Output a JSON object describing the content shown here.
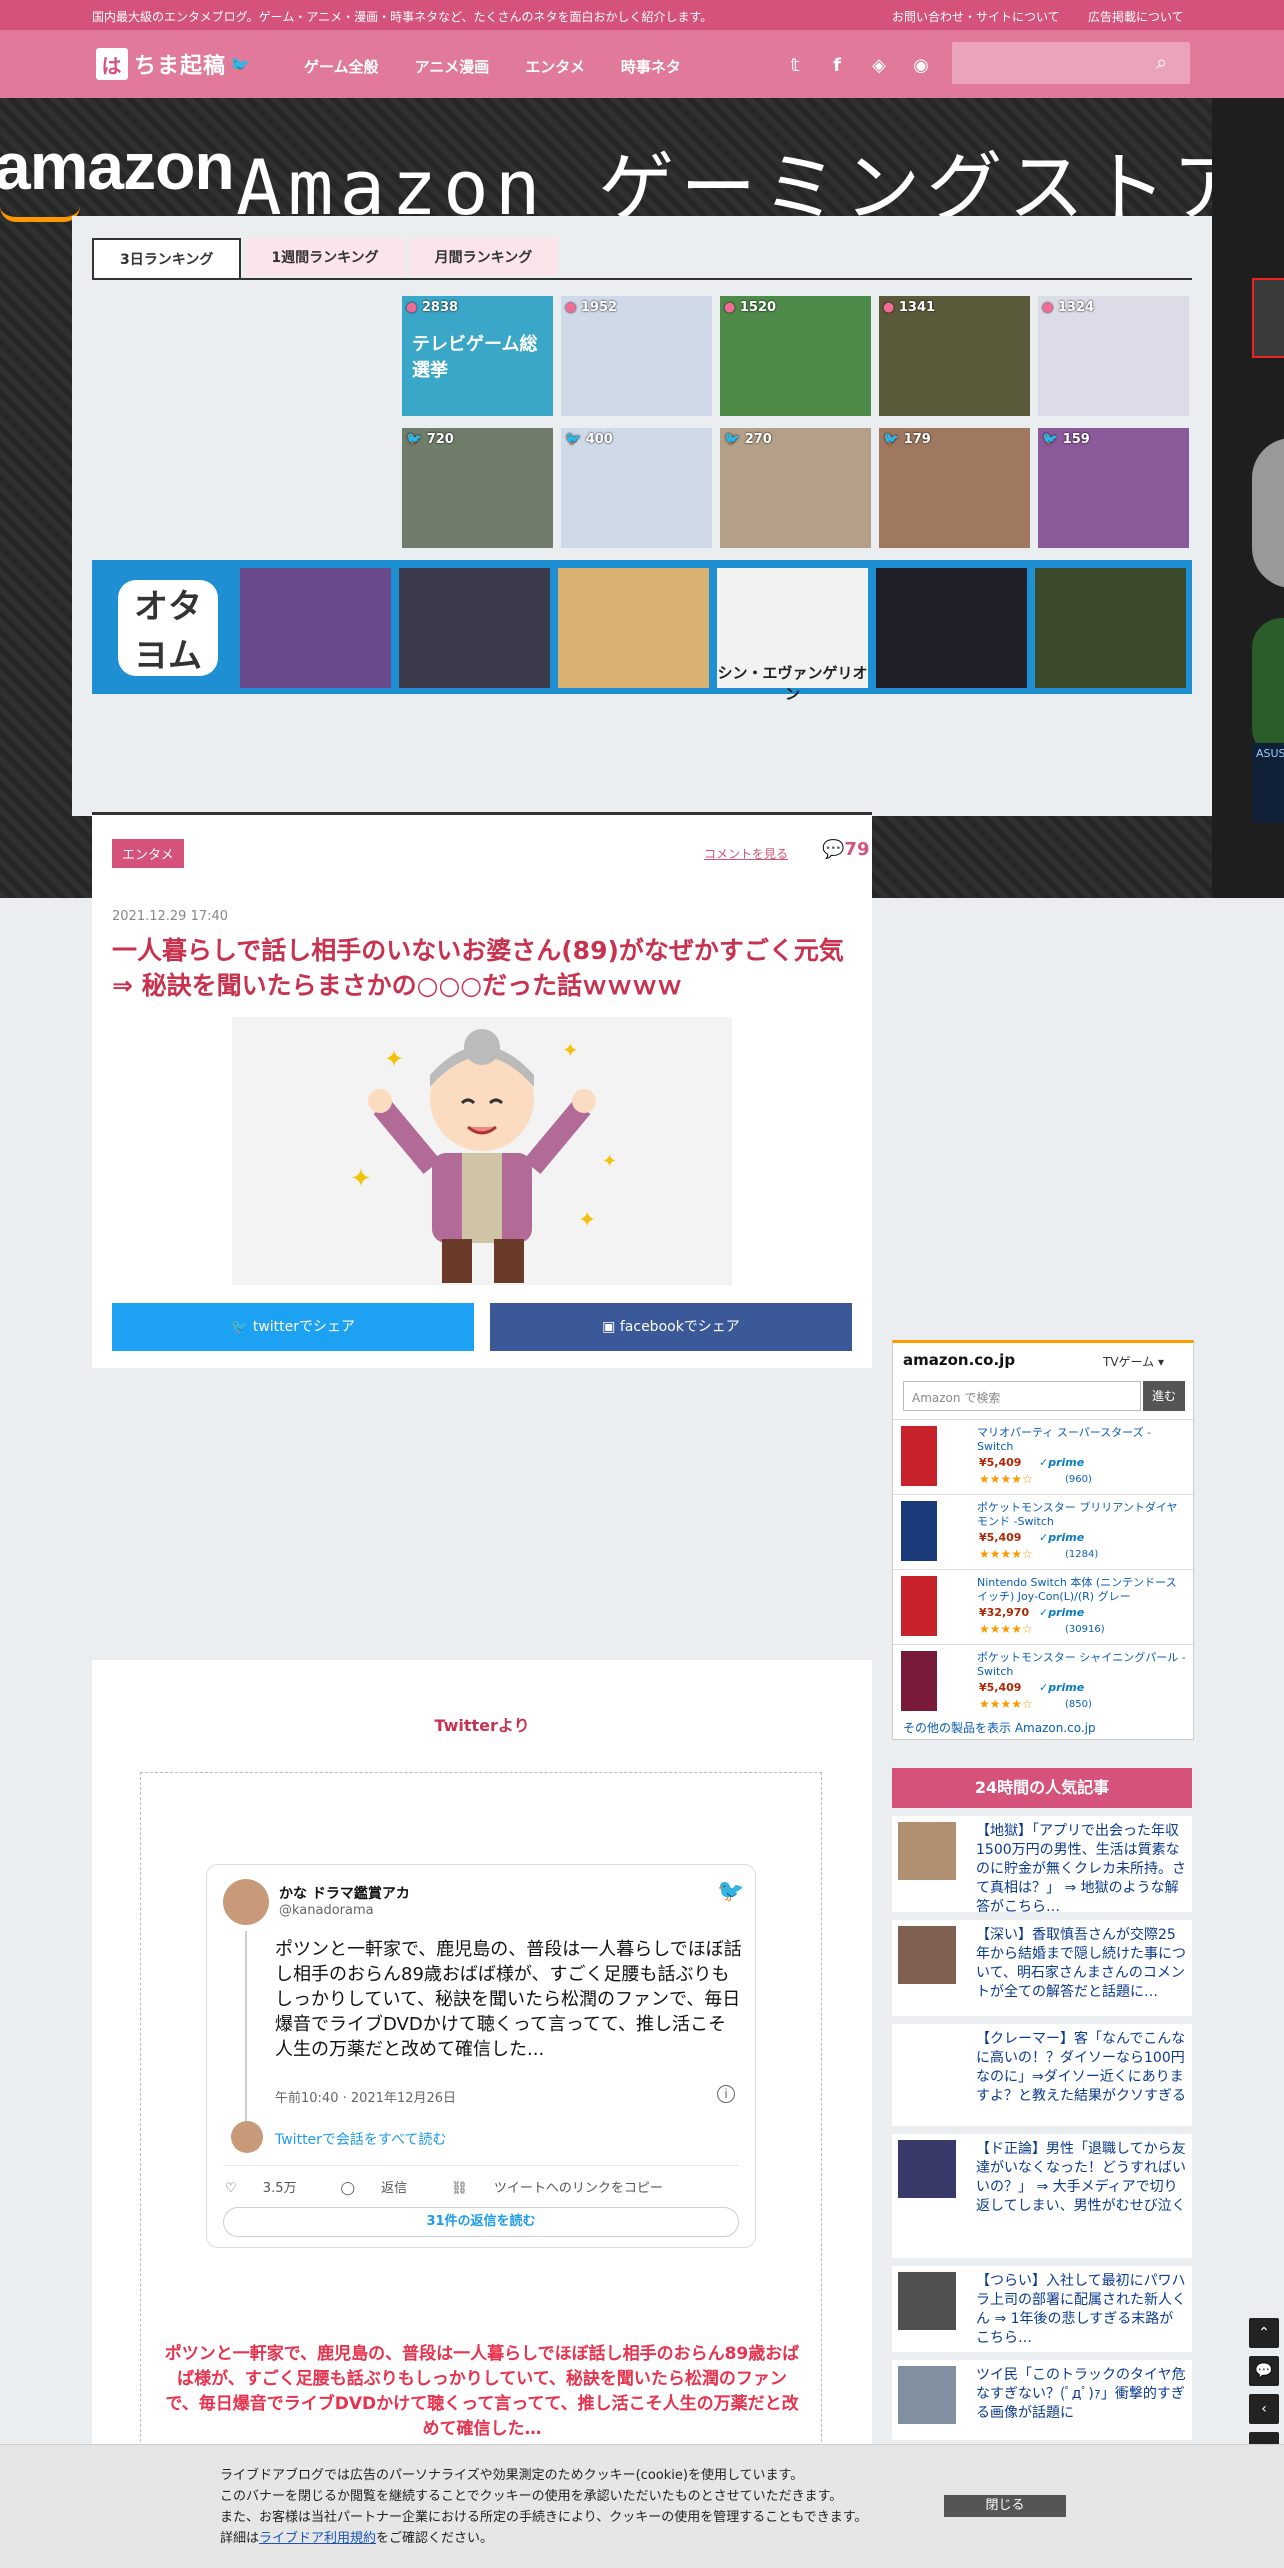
{
  "topbar": {
    "description": "国内最大級のエンタメブログ。ゲーム・アニメ・漫画・時事ネタなど、たくさんのネタを面白おかしく紹介します。",
    "links": [
      "お問い合わせ・サイトについて",
      "広告掲載について"
    ]
  },
  "header": {
    "logo_mark": "は",
    "logo_text": "ちま起稿",
    "nav": [
      "ゲーム全般",
      "アニメ漫画",
      "エンタメ",
      "時事ネタ"
    ],
    "social_icons": [
      "twitter-icon",
      "facebook-icon",
      "feedly-icon",
      "rss-icon"
    ],
    "search_placeholder": ""
  },
  "banner": {
    "brand": "amazon",
    "headline": "Amazon ゲーミングストア"
  },
  "ranking": {
    "tabs": [
      "3日ランキング",
      "1週間ランキング",
      "月間ランキング"
    ],
    "row1": [
      {
        "count": "2838",
        "thumb_text": "テレビゲーム総選挙",
        "color": "#3aa6c8"
      },
      {
        "count": "1952",
        "thumb_text": "",
        "color": "#cfd9e8"
      },
      {
        "count": "1520",
        "thumb_text": "",
        "color": "#4e8a48"
      },
      {
        "count": "1341",
        "thumb_text": "",
        "color": "#5a5a3a"
      },
      {
        "count": "1324",
        "thumb_text": "",
        "color": "#dcdce8"
      }
    ],
    "row2": [
      {
        "count": "720",
        "thumb_text": "",
        "color": "#6f7d6a"
      },
      {
        "count": "400",
        "thumb_text": "",
        "color": "#cfd9e8"
      },
      {
        "count": "270",
        "thumb_text": "",
        "color": "#b4a088"
      },
      {
        "count": "179",
        "thumb_text": "",
        "color": "#a07860"
      },
      {
        "count": "159",
        "thumb_text": "",
        "color": "#8a5a9a"
      }
    ]
  },
  "okyu": {
    "logo": "オタ\nヨム",
    "thumb_colors": [
      "#6a4a8a",
      "#3a3a4a",
      "#d8b070",
      "#f2f2f2",
      "#202028",
      "#3a4a2a"
    ],
    "evangelion": "シン・エヴァンゲリオン"
  },
  "article": {
    "tag": "エンタメ",
    "comment_link": "コメントを見る",
    "comment_count": "79",
    "date": "2021.12.29 17:40",
    "title": "一人暮らしで話し相手のいないお婆さん(89)がなぜかすごく元気 ⇒ 秘訣を聞いたらまさかの○○○だった話ｗｗｗｗ",
    "share_twitter": "twitterでシェア",
    "share_facebook": "facebookでシェア"
  },
  "body": {
    "source": "Twitterより",
    "tweet": {
      "name": "かな ドラマ鑑賞アカ",
      "handle": "@kanadorama",
      "text": "ポツンと一軒家で、鹿児島の、普段は一人暮らしでほぼ話し相手のおらん89歳おばば様が、すごく足腰も話ぶりもしっかりしていて、秘訣を聞いたら松潤のファンで、毎日爆音でライブDVDかけて聴くって言ってて、推し活こそ人生の万薬だと改めて確信した...",
      "time": "午前10:40 · 2021年12月26日",
      "read_all": "Twitterで会話をすべて読む",
      "likes": "3.5万",
      "reply": "返信",
      "copy": "ツイートへのリンクをコピー",
      "replies": "31件の返信を読む"
    },
    "quote": "ポツンと一軒家で、鹿児島の、普段は一人暮らしでほぼ話し相手のおらん89歳おばば様が、すごく足腰も話ぶりもしっかりしていて、秘訣を聞いたら松潤のファンで、毎日爆音でライブDVDかけて聴くって言ってて、推し活こそ人生の万薬だと改めて確信した…"
  },
  "amazon": {
    "logo": "amazon.co.jp",
    "category": "TVゲーム",
    "search_placeholder": "Amazon で検索",
    "go": "進む",
    "items": [
      {
        "name": "マリオパーティ スーパースターズ -Switch",
        "price": "¥5,409",
        "prime": "✓prime",
        "stars": "★★★★☆",
        "reviews": "(960)"
      },
      {
        "name": "ポケットモンスター ブリリアントダイヤモンド -Switch",
        "price": "¥5,409",
        "prime": "✓prime",
        "stars": "★★★★☆",
        "reviews": "(1284)"
      },
      {
        "name": "Nintendo Switch 本体 (ニンテンドースイッチ) Joy-Con(L)/(R) グレー",
        "price": "¥32,970",
        "prime": "✓prime",
        "stars": "★★★★☆",
        "reviews": "(30916)"
      },
      {
        "name": "ポケットモンスター シャイニングパール -Switch",
        "price": "¥5,409",
        "prime": "✓prime",
        "stars": "★★★★☆",
        "reviews": "(850)"
      }
    ],
    "more": "その他の製品を表示 Amazon.co.jp"
  },
  "popular": {
    "heading": "24時間の人気記事",
    "items": [
      "【地獄】「アプリで出会った年収1500万円の男性、生活は質素なのに貯金が無くクレカ未所持。さて真相は？」 ⇒ 地獄のような解答がこちら…",
      "【深い】香取慎吾さんが交際25年から結婚まで隠し続けた事について、明石家さんまさんのコメントが全ての解答だと話題に…",
      "【クレーマー】客「なんでこんなに高いの！？ダイソーなら100円なのに」⇒ダイソー近くにありますよ？と教えた結果がクソすぎる",
      "【ド正論】男性「退職してから友達がいなくなった！どうすればいいの？」 ⇒ 大手メディアで切り返してしまい、男性がむせび泣く",
      "【つらい】入社して最初にパワハラ上司の部署に配属された新人くん ⇒ 1年後の悲しすぎる末路がこちら…",
      "ツイ民「このトラックのタイヤ危なすぎない？(ﾟдﾟ)ｧ」衝撃的すぎる画像が話題に"
    ]
  },
  "cookie": {
    "line1": "ライブドアブログでは広告のパーソナライズや効果測定のためクッキー(cookie)を使用しています。",
    "line2": "このバナーを閉じるか閲覧を継続することでクッキーの使用を承認いただいたものとさせていただきます。",
    "line3": "また、お客様は当社パートナー企業における所定の手続きにより、クッキーの使用を管理することもできます。",
    "line4_pre": "詳細は",
    "line4_link": "ライブドア利用規約",
    "line4_post": "をご確認ください。",
    "close": "閉じる"
  }
}
